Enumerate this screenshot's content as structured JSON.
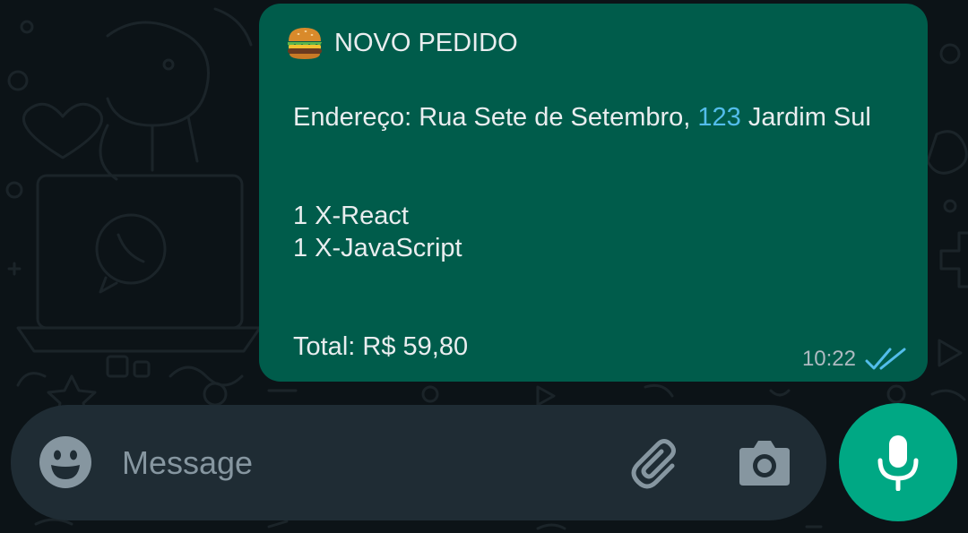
{
  "chat": {
    "message": {
      "header_emoji": "burger-icon",
      "header_text": "NOVO PEDIDO",
      "address_prefix": "Endereço: Rua Sete de Setembro, ",
      "address_number": "123",
      "address_suffix": " Jardim Sul",
      "items": [
        "1 X-React",
        "1 X-JavaScript"
      ],
      "total": "Total: R$ 59,80",
      "time": "10:22",
      "status": "read",
      "status_icon": "double-check-icon",
      "colors": {
        "bubble": "#005c4b",
        "text": "#e9edef",
        "link": "#53bdeb",
        "meta": "#aebac1"
      }
    }
  },
  "composer": {
    "placeholder": "Message",
    "emoji_icon": "emoji-icon",
    "attach_icon": "paperclip-icon",
    "camera_icon": "camera-icon",
    "mic_icon": "microphone-icon",
    "colors": {
      "bar": "#1f2c34",
      "icon": "#8696a0",
      "mic_button": "#00a884"
    }
  },
  "theme": {
    "background": "#0c1317"
  }
}
